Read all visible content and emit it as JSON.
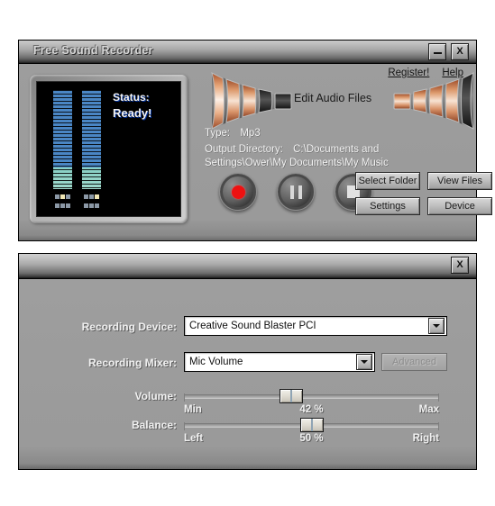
{
  "app": {
    "title": "Free Sound Recorder"
  },
  "titlebar": {
    "minimize_label": "–",
    "close_label": "X"
  },
  "display": {
    "status_label": "Status:",
    "status_value": "Ready!",
    "meter_left_name": "left-channel-meter",
    "meter_right_name": "right-channel-meter"
  },
  "header": {
    "register_link": "Register!",
    "help_link": "Help",
    "edit_audio_files": "Edit Audio Files",
    "type_label": "Type:",
    "type_value": "Mp3",
    "output_dir_label": "Output Directory:",
    "output_dir_value_line1": "C:\\Documents and",
    "output_dir_value_line2": "Settings\\Ower\\My Documents\\My Music"
  },
  "transport": {
    "record": "record-button",
    "pause": "pause-button",
    "stop": "stop-button"
  },
  "actions": {
    "select_folder": "Select Folder",
    "view_files": "View Files",
    "settings": "Settings",
    "device": "Device"
  },
  "device_panel": {
    "close_label": "X",
    "recording_device_label": "Recording Device:",
    "recording_device_value": "Creative Sound Blaster PCI",
    "recording_mixer_label": "Recording Mixer:",
    "recording_mixer_value": "Mic Volume",
    "advanced_label": "Advanced",
    "volume_label": "Volume:",
    "volume_min": "Min",
    "volume_value": "42 %",
    "volume_max": "Max",
    "volume_percent": 42,
    "balance_label": "Balance:",
    "balance_left": "Left",
    "balance_value": "50 %",
    "balance_right": "Right",
    "balance_percent": 50
  },
  "colors": {
    "window_face": "#9a9a9a",
    "screen_bg": "#000000",
    "meter_blue": "#4a86c4",
    "meter_teal": "#9fd9cc",
    "record_red": "#ee1111",
    "horn_orange": "#c96a33",
    "label_text": "#f0f0f0"
  }
}
